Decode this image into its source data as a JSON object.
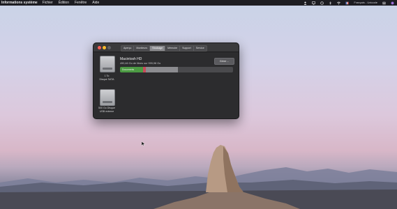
{
  "menubar": {
    "app": "Informations système",
    "items": [
      "Fichier",
      "Édition",
      "Fenêtre",
      "Aide"
    ],
    "status_text": "Français - Unicode",
    "icons": [
      "user-icon",
      "screen-mirroring-icon",
      "time-machine-icon",
      "bluetooth-icon",
      "wifi-icon",
      "input-source-icon",
      "control-center-icon",
      "siri-icon"
    ]
  },
  "window": {
    "tabs": [
      "Aperçu",
      "Moniteurs",
      "Stockage",
      "Mémoire",
      "Support",
      "Service"
    ],
    "selected_tab": "Stockage",
    "volume": {
      "name": "Macintosh HD",
      "space": "490,46 Go de libres sur 999,98 Go",
      "manage_label": "Gérer…",
      "documents_label": "Documents",
      "usage_fraction": 0.51
    },
    "disks": [
      {
        "label_line1": "1 To",
        "label_line2": "Disque SATA"
      },
      {
        "label_line1": "500 Go Disque",
        "label_line2": "USB externe"
      }
    ]
  },
  "colors": {
    "documents": "#4c9a43",
    "accent_red": "#c94a5a"
  }
}
